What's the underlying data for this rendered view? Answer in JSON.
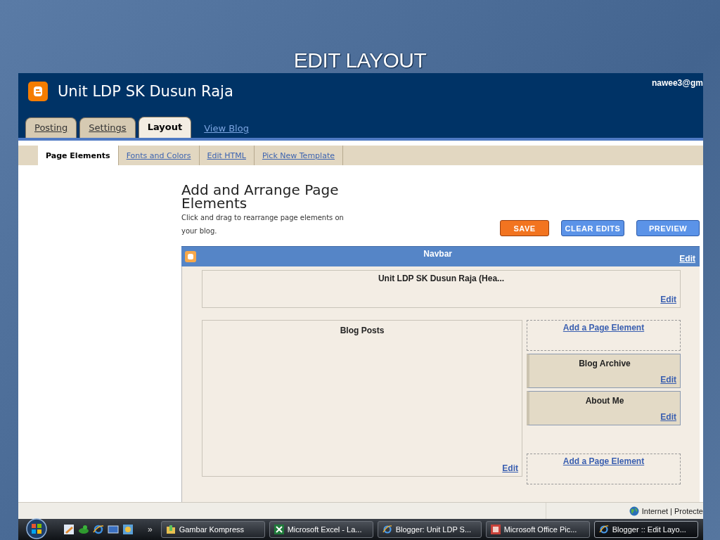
{
  "slide_title": "EDIT LAYOUT",
  "blog": {
    "title": "Unit LDP SK Dusun Raja",
    "account": "nawee3@gm"
  },
  "tabs": [
    {
      "label": "Posting",
      "selected": false
    },
    {
      "label": "Settings",
      "selected": false
    },
    {
      "label": "Layout",
      "selected": true
    }
  ],
  "view_blog": "View Blog",
  "subtabs": [
    {
      "label": "Page Elements",
      "selected": true
    },
    {
      "label": "Fonts and Colors",
      "selected": false
    },
    {
      "label": "Edit HTML",
      "selected": false
    },
    {
      "label": "Pick New Template",
      "selected": false
    }
  ],
  "heading": "Add and Arrange Page Elements",
  "description": "Click and drag to rearrange page elements on your blog.",
  "buttons": [
    {
      "label": "SAVE",
      "kind": "primary"
    },
    {
      "label": "CLEAR EDITS",
      "kind": "secondary"
    },
    {
      "label": "PREVIEW",
      "kind": "secondary"
    }
  ],
  "navbar": {
    "title": "Navbar",
    "edit": "Edit"
  },
  "header_element": {
    "title": "Unit LDP SK Dusun Raja (Hea...",
    "edit": "Edit"
  },
  "main_column": {
    "title": "Blog Posts",
    "edit": "Edit"
  },
  "sidebar": [
    {
      "kind": "add",
      "label": "Add a Page Element"
    },
    {
      "kind": "widget",
      "title": "Blog Archive",
      "edit": "Edit"
    },
    {
      "kind": "widget",
      "title": "About Me",
      "edit": "Edit"
    },
    {
      "kind": "add",
      "label": "Add a Page Element"
    }
  ],
  "status_bar": {
    "zone": "Internet | Protecte"
  },
  "taskbar": {
    "more": "»",
    "tasks": [
      {
        "label": "Gambar Kompress",
        "kind": "folder",
        "selected": false
      },
      {
        "label": "Microsoft Excel - La...",
        "kind": "excel",
        "selected": false
      },
      {
        "label": "Blogger: Unit LDP S...",
        "kind": "browser",
        "selected": false
      },
      {
        "label": "Microsoft Office Pic...",
        "kind": "picture",
        "selected": false
      },
      {
        "label": "Blogger :: Edit Layo...",
        "kind": "browser",
        "selected": true
      }
    ]
  }
}
